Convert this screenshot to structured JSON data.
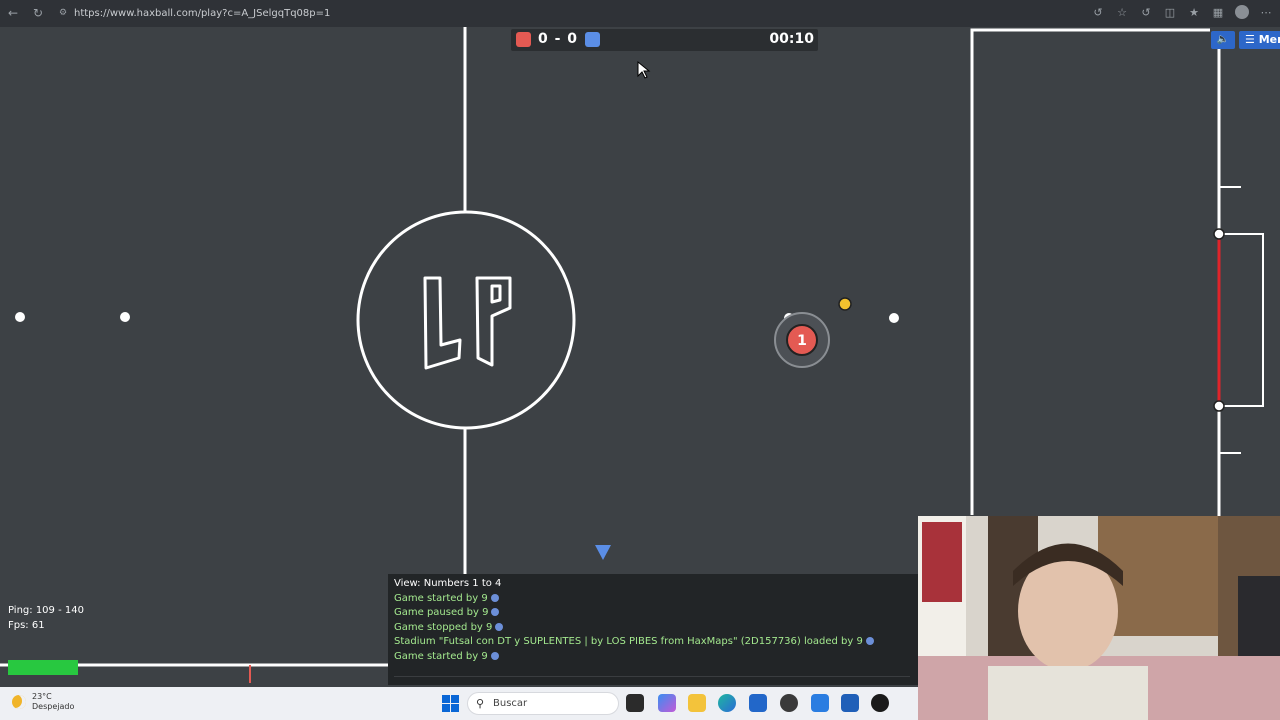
{
  "browser": {
    "url": "https://www.haxball.com/play?c=A_JSelgqTq08p=1"
  },
  "scoreboard": {
    "score": "0 - 0",
    "time": "00:10",
    "red_color": "#e45a53",
    "blue_color": "#5b8ee6"
  },
  "top_buttons": {
    "sound_icon": "speaker-icon",
    "menu_label": "Menu"
  },
  "field": {
    "logo_text": "LP",
    "player_number": "1",
    "player_color": "#e45a53",
    "ball_color": "#f2c12e",
    "goal_post_color": "#e0242a"
  },
  "stats": {
    "ping": "Ping: 109 - 140",
    "fps": "Fps: 61"
  },
  "chat": {
    "lines": [
      "View: Numbers 1 to 4",
      "Game started by 9",
      "Game paused by 9",
      "Game stopped by 9",
      "Stadium \"Futsal con DT y SUPLENTES | by LOS PIBES from HaxMaps\" (2D157736) loaded by 9",
      "Game started by 9"
    ]
  },
  "taskbar": {
    "temperature": "23°C",
    "weather": "Despejado",
    "search_label": "Buscar"
  }
}
